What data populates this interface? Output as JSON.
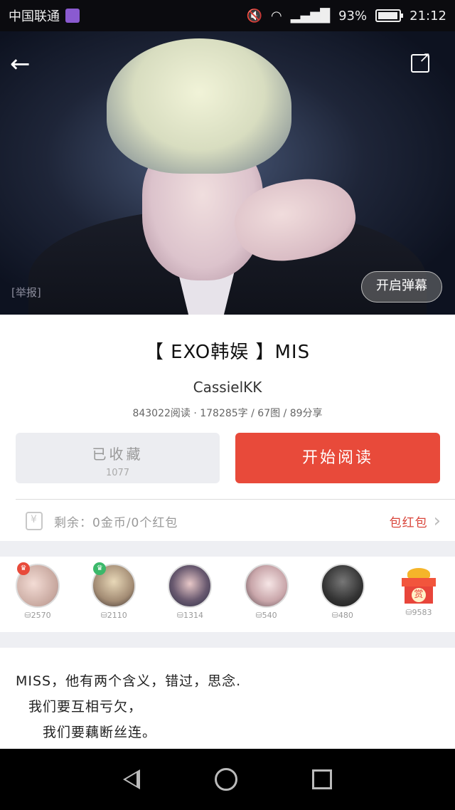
{
  "status_bar": {
    "carrier": "中国联通",
    "battery": "93%",
    "time": "21:12",
    "battery_level": 0.93
  },
  "hero": {
    "report_label": "[举报]",
    "danmu_label": "开启弹幕"
  },
  "post": {
    "title": "【 EXO韩娱 】MIS",
    "author": "CassielKK",
    "stats": "843022阅读 · 178285字 / 67图 / 89分享"
  },
  "actions": {
    "favorited_label": "已收藏",
    "favorited_count": "1077",
    "read_label": "开始阅读"
  },
  "wallet": {
    "remaining": "剩余：0金币/0个红包",
    "red_packet_label": "包红包"
  },
  "gifters": [
    {
      "amount": "2570",
      "badge": "♛"
    },
    {
      "amount": "2110",
      "badge": "♛"
    },
    {
      "amount": "1314",
      "badge": ""
    },
    {
      "amount": "540",
      "badge": ""
    },
    {
      "amount": "480",
      "badge": ""
    },
    {
      "amount": "9583",
      "gift_label": "赏"
    }
  ],
  "description": {
    "line1": "MISS，他有两个含义，错过，思念.",
    "line2": "我们要互相亏欠，",
    "line3": "我们要藕断丝连。"
  },
  "colors": {
    "accent": "#e84a3a",
    "badge_red": "#e84a3a",
    "badge_green": "#3bb86a"
  }
}
